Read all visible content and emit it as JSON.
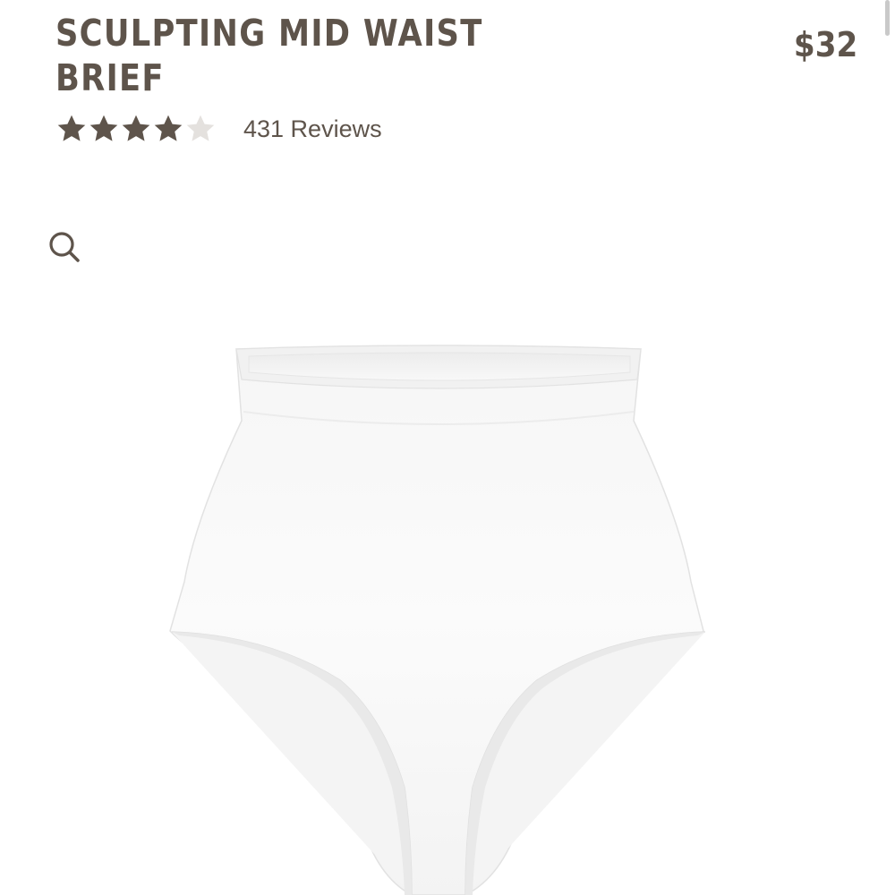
{
  "colors": {
    "text": "#5e544b",
    "star_filled": "#5e544b",
    "star_empty": "#e4e1de",
    "background": "#ffffff"
  },
  "product": {
    "title": "SCULPTING MID WAIST BRIEF",
    "price": "$32"
  },
  "rating": {
    "value": 4,
    "max": 5,
    "reviews_label": "431 Reviews"
  },
  "icons": {
    "zoom": "search-icon",
    "star": "star-icon"
  },
  "image": {
    "subject": "white mid waist brief"
  }
}
